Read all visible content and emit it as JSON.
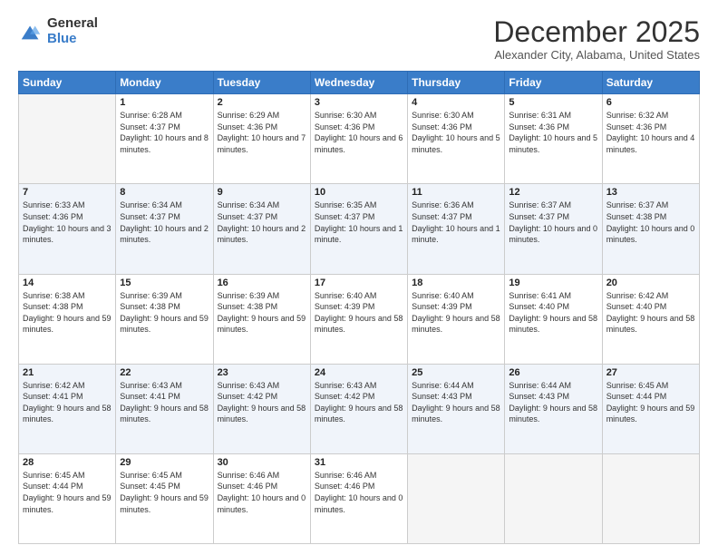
{
  "logo": {
    "general": "General",
    "blue": "Blue"
  },
  "title": "December 2025",
  "subtitle": "Alexander City, Alabama, United States",
  "days_of_week": [
    "Sunday",
    "Monday",
    "Tuesday",
    "Wednesday",
    "Thursday",
    "Friday",
    "Saturday"
  ],
  "weeks": [
    [
      {
        "num": "",
        "sunrise": "",
        "sunset": "",
        "daylight": "",
        "empty": true
      },
      {
        "num": "1",
        "sunrise": "Sunrise: 6:28 AM",
        "sunset": "Sunset: 4:37 PM",
        "daylight": "Daylight: 10 hours and 8 minutes."
      },
      {
        "num": "2",
        "sunrise": "Sunrise: 6:29 AM",
        "sunset": "Sunset: 4:36 PM",
        "daylight": "Daylight: 10 hours and 7 minutes."
      },
      {
        "num": "3",
        "sunrise": "Sunrise: 6:30 AM",
        "sunset": "Sunset: 4:36 PM",
        "daylight": "Daylight: 10 hours and 6 minutes."
      },
      {
        "num": "4",
        "sunrise": "Sunrise: 6:30 AM",
        "sunset": "Sunset: 4:36 PM",
        "daylight": "Daylight: 10 hours and 5 minutes."
      },
      {
        "num": "5",
        "sunrise": "Sunrise: 6:31 AM",
        "sunset": "Sunset: 4:36 PM",
        "daylight": "Daylight: 10 hours and 5 minutes."
      },
      {
        "num": "6",
        "sunrise": "Sunrise: 6:32 AM",
        "sunset": "Sunset: 4:36 PM",
        "daylight": "Daylight: 10 hours and 4 minutes."
      }
    ],
    [
      {
        "num": "7",
        "sunrise": "Sunrise: 6:33 AM",
        "sunset": "Sunset: 4:36 PM",
        "daylight": "Daylight: 10 hours and 3 minutes."
      },
      {
        "num": "8",
        "sunrise": "Sunrise: 6:34 AM",
        "sunset": "Sunset: 4:37 PM",
        "daylight": "Daylight: 10 hours and 2 minutes."
      },
      {
        "num": "9",
        "sunrise": "Sunrise: 6:34 AM",
        "sunset": "Sunset: 4:37 PM",
        "daylight": "Daylight: 10 hours and 2 minutes."
      },
      {
        "num": "10",
        "sunrise": "Sunrise: 6:35 AM",
        "sunset": "Sunset: 4:37 PM",
        "daylight": "Daylight: 10 hours and 1 minute."
      },
      {
        "num": "11",
        "sunrise": "Sunrise: 6:36 AM",
        "sunset": "Sunset: 4:37 PM",
        "daylight": "Daylight: 10 hours and 1 minute."
      },
      {
        "num": "12",
        "sunrise": "Sunrise: 6:37 AM",
        "sunset": "Sunset: 4:37 PM",
        "daylight": "Daylight: 10 hours and 0 minutes."
      },
      {
        "num": "13",
        "sunrise": "Sunrise: 6:37 AM",
        "sunset": "Sunset: 4:38 PM",
        "daylight": "Daylight: 10 hours and 0 minutes."
      }
    ],
    [
      {
        "num": "14",
        "sunrise": "Sunrise: 6:38 AM",
        "sunset": "Sunset: 4:38 PM",
        "daylight": "Daylight: 9 hours and 59 minutes."
      },
      {
        "num": "15",
        "sunrise": "Sunrise: 6:39 AM",
        "sunset": "Sunset: 4:38 PM",
        "daylight": "Daylight: 9 hours and 59 minutes."
      },
      {
        "num": "16",
        "sunrise": "Sunrise: 6:39 AM",
        "sunset": "Sunset: 4:38 PM",
        "daylight": "Daylight: 9 hours and 59 minutes."
      },
      {
        "num": "17",
        "sunrise": "Sunrise: 6:40 AM",
        "sunset": "Sunset: 4:39 PM",
        "daylight": "Daylight: 9 hours and 58 minutes."
      },
      {
        "num": "18",
        "sunrise": "Sunrise: 6:40 AM",
        "sunset": "Sunset: 4:39 PM",
        "daylight": "Daylight: 9 hours and 58 minutes."
      },
      {
        "num": "19",
        "sunrise": "Sunrise: 6:41 AM",
        "sunset": "Sunset: 4:40 PM",
        "daylight": "Daylight: 9 hours and 58 minutes."
      },
      {
        "num": "20",
        "sunrise": "Sunrise: 6:42 AM",
        "sunset": "Sunset: 4:40 PM",
        "daylight": "Daylight: 9 hours and 58 minutes."
      }
    ],
    [
      {
        "num": "21",
        "sunrise": "Sunrise: 6:42 AM",
        "sunset": "Sunset: 4:41 PM",
        "daylight": "Daylight: 9 hours and 58 minutes."
      },
      {
        "num": "22",
        "sunrise": "Sunrise: 6:43 AM",
        "sunset": "Sunset: 4:41 PM",
        "daylight": "Daylight: 9 hours and 58 minutes."
      },
      {
        "num": "23",
        "sunrise": "Sunrise: 6:43 AM",
        "sunset": "Sunset: 4:42 PM",
        "daylight": "Daylight: 9 hours and 58 minutes."
      },
      {
        "num": "24",
        "sunrise": "Sunrise: 6:43 AM",
        "sunset": "Sunset: 4:42 PM",
        "daylight": "Daylight: 9 hours and 58 minutes."
      },
      {
        "num": "25",
        "sunrise": "Sunrise: 6:44 AM",
        "sunset": "Sunset: 4:43 PM",
        "daylight": "Daylight: 9 hours and 58 minutes."
      },
      {
        "num": "26",
        "sunrise": "Sunrise: 6:44 AM",
        "sunset": "Sunset: 4:43 PM",
        "daylight": "Daylight: 9 hours and 58 minutes."
      },
      {
        "num": "27",
        "sunrise": "Sunrise: 6:45 AM",
        "sunset": "Sunset: 4:44 PM",
        "daylight": "Daylight: 9 hours and 59 minutes."
      }
    ],
    [
      {
        "num": "28",
        "sunrise": "Sunrise: 6:45 AM",
        "sunset": "Sunset: 4:44 PM",
        "daylight": "Daylight: 9 hours and 59 minutes."
      },
      {
        "num": "29",
        "sunrise": "Sunrise: 6:45 AM",
        "sunset": "Sunset: 4:45 PM",
        "daylight": "Daylight: 9 hours and 59 minutes."
      },
      {
        "num": "30",
        "sunrise": "Sunrise: 6:46 AM",
        "sunset": "Sunset: 4:46 PM",
        "daylight": "Daylight: 10 hours and 0 minutes."
      },
      {
        "num": "31",
        "sunrise": "Sunrise: 6:46 AM",
        "sunset": "Sunset: 4:46 PM",
        "daylight": "Daylight: 10 hours and 0 minutes."
      },
      {
        "num": "",
        "sunrise": "",
        "sunset": "",
        "daylight": "",
        "empty": true
      },
      {
        "num": "",
        "sunrise": "",
        "sunset": "",
        "daylight": "",
        "empty": true
      },
      {
        "num": "",
        "sunrise": "",
        "sunset": "",
        "daylight": "",
        "empty": true
      }
    ]
  ]
}
